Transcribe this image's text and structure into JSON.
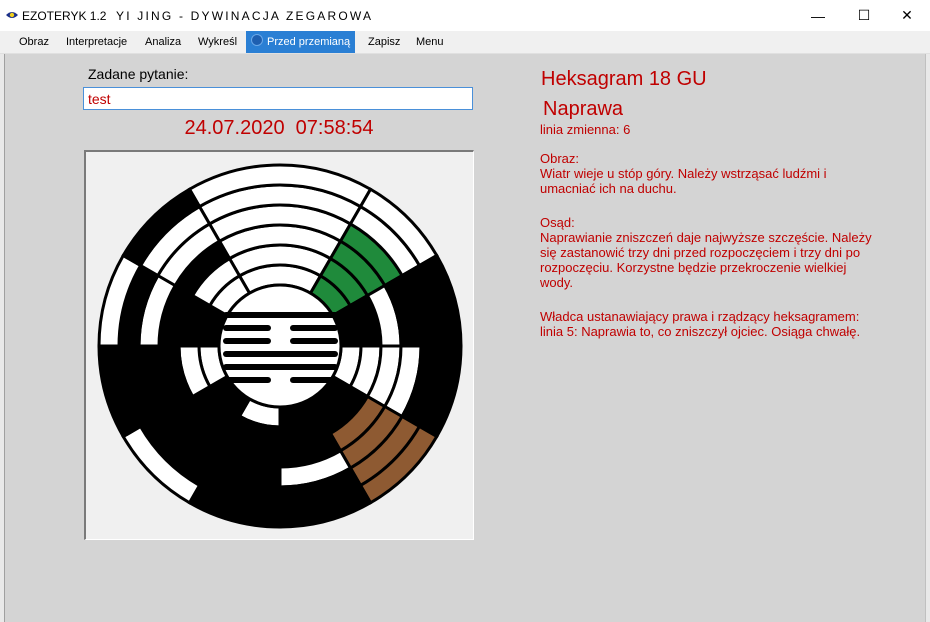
{
  "window": {
    "app_name": "EZOTERYK 1.2",
    "caption": "YI JING - DYWINACJA ZEGAROWA",
    "minimize": "—",
    "maximize": "☐",
    "close": "✕"
  },
  "menu": {
    "items": [
      "Obraz",
      "Interpretacje",
      "Analiza",
      "Wykreśl",
      "Przed przemianą",
      "Zapisz",
      "Menu"
    ],
    "active_index": 4
  },
  "question": {
    "label": "Zadane pytanie:",
    "value": "test"
  },
  "datetime": "24.07.2020  07:58:54",
  "hexagram": {
    "title": "Heksagram 18 GU",
    "name": "Naprawa",
    "changing_line": "linia zmienna: 6",
    "image_heading": "Obraz:",
    "image_text": "Wiatr wieje u stóp góry. Należy wstrząsać ludźmi i umacniać ich na duchu.",
    "judgement_heading": "Osąd:",
    "judgement_text": "Naprawianie zniszczeń daje najwyższe szczęście. Należy się zastanowić trzy dni przed rozpoczęciem i trzy dni po rozpoczęciu. Korzystne będzie przekroczenie wielkiej wody.",
    "ruler_heading": "Władca ustanawiający prawa i rządzący heksagramem:",
    "ruler_text": "linia 5: Naprawia to, co zniszczył ojciec. Osiąga chwałę."
  },
  "colors": {
    "accent_red": "#c00000",
    "highlight_green": "#1f8a3b",
    "highlight_brown": "#8e5a32",
    "menu_active": "#2a7fd4"
  }
}
